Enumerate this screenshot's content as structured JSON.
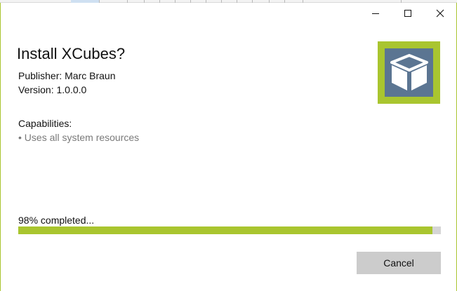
{
  "window": {
    "controls": {
      "minimize_icon": "minimize-icon",
      "maximize_icon": "maximize-icon",
      "close_icon": "close-icon"
    }
  },
  "app": {
    "title": "Install XCubes?",
    "publisher": "Publisher: Marc Braun",
    "version": "Version: 1.0.0.0",
    "logo_icon": "cube-icon"
  },
  "capabilities": {
    "heading": "Capabilities:",
    "items": [
      "• Uses all system resources"
    ]
  },
  "progress": {
    "label": "98% completed...",
    "percent": 98
  },
  "actions": {
    "cancel_label": "Cancel"
  },
  "colors": {
    "accent": "#a9c52f",
    "logo_background": "#5b7592",
    "track": "#d5d5d5",
    "button": "#cccccc"
  }
}
